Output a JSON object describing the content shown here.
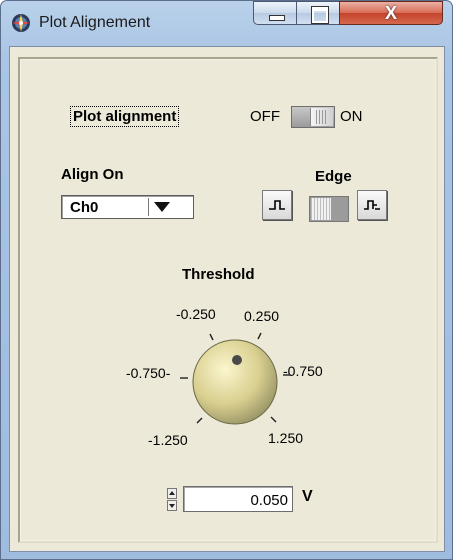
{
  "window": {
    "title": "Plot Alignement",
    "accent_color": "#9fbbde",
    "close_color": "#c4432b"
  },
  "caption_buttons": {
    "close_symbol": "X"
  },
  "plot_alignment": {
    "label": "Plot alignment",
    "off_label": "OFF",
    "on_label": "ON",
    "state": "ON"
  },
  "align_on": {
    "label": "Align On",
    "selected": "Ch0"
  },
  "edge": {
    "label": "Edge",
    "falling_icon": "falling-edge-icon",
    "rising_icon": "rising-edge-icon"
  },
  "threshold": {
    "label": "Threshold",
    "ticks": [
      "-1.250",
      "-0.750",
      "-0.250",
      "0.250",
      "0.750",
      "1.250"
    ],
    "tick_marks": {
      "left_minus_0750": "-0.750-",
      "right_0750": "-0.750"
    },
    "value": "0.050",
    "unit": "V"
  }
}
